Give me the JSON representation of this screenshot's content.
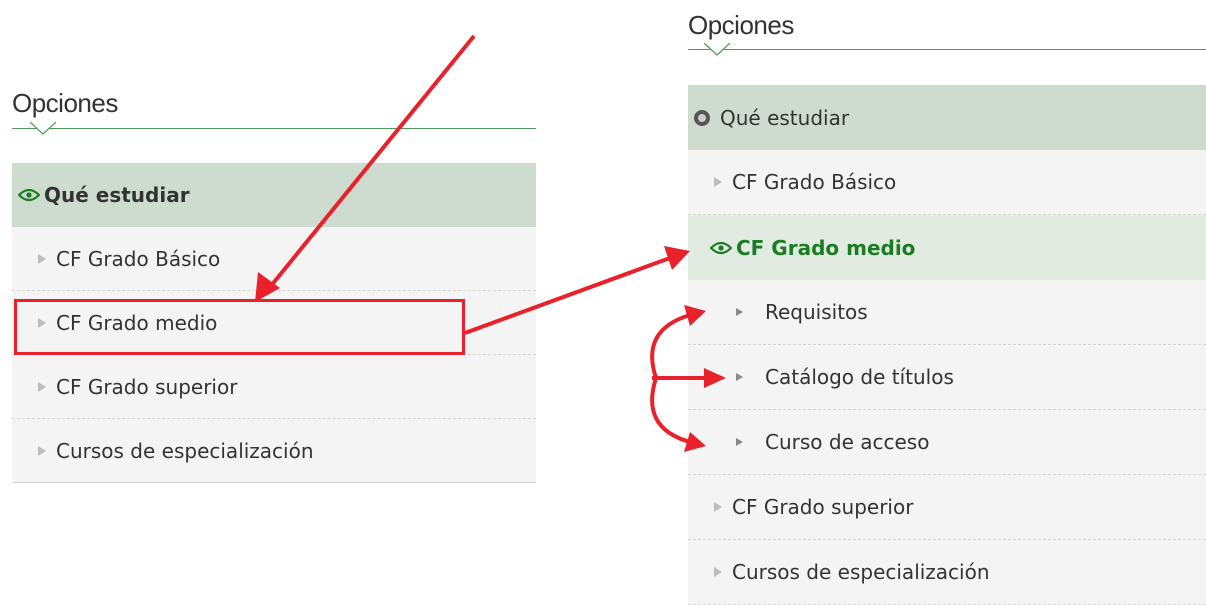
{
  "left_panel": {
    "heading": "Opciones",
    "items": [
      {
        "label": "Qué estudiar"
      },
      {
        "label": "CF Grado Básico"
      },
      {
        "label": "CF Grado medio"
      },
      {
        "label": "CF Grado superior"
      },
      {
        "label": "Cursos de especialización"
      }
    ]
  },
  "right_panel": {
    "heading": "Opciones",
    "items": [
      {
        "label": "Qué estudiar"
      },
      {
        "label": "CF Grado Básico"
      },
      {
        "label": "CF Grado medio"
      },
      {
        "label": "Requisitos"
      },
      {
        "label": "Catálogo de títulos"
      },
      {
        "label": "Curso de acceso"
      },
      {
        "label": "CF Grado superior"
      },
      {
        "label": "Cursos de especialización"
      }
    ]
  },
  "colors": {
    "accent_green": "#1b7c22",
    "annotation_red": "#e8212b",
    "header_bg": "#cddccf",
    "item_bg": "#f4f4f4"
  }
}
